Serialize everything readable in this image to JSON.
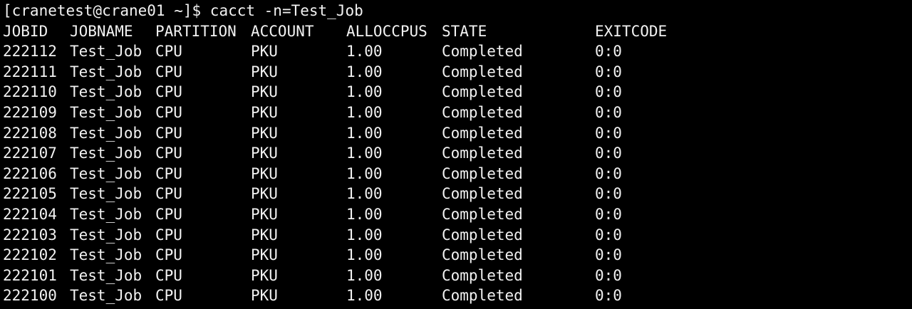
{
  "terminal": {
    "prompt": "[cranetest@crane01 ~]$ ",
    "command": "cacct -n=Test_Job",
    "colors": {
      "background": "#000000",
      "foreground": "#f2f2f2"
    },
    "headers": [
      "JOBID",
      "JOBNAME",
      "PARTITION",
      "ACCOUNT",
      "ALLOCCPUS",
      "STATE",
      "EXITCODE"
    ],
    "rows": [
      [
        "222112",
        "Test_Job",
        "CPU",
        "PKU",
        "1.00",
        "Completed",
        "0:0"
      ],
      [
        "222111",
        "Test_Job",
        "CPU",
        "PKU",
        "1.00",
        "Completed",
        "0:0"
      ],
      [
        "222110",
        "Test_Job",
        "CPU",
        "PKU",
        "1.00",
        "Completed",
        "0:0"
      ],
      [
        "222109",
        "Test_Job",
        "CPU",
        "PKU",
        "1.00",
        "Completed",
        "0:0"
      ],
      [
        "222108",
        "Test_Job",
        "CPU",
        "PKU",
        "1.00",
        "Completed",
        "0:0"
      ],
      [
        "222107",
        "Test_Job",
        "CPU",
        "PKU",
        "1.00",
        "Completed",
        "0:0"
      ],
      [
        "222106",
        "Test_Job",
        "CPU",
        "PKU",
        "1.00",
        "Completed",
        "0:0"
      ],
      [
        "222105",
        "Test_Job",
        "CPU",
        "PKU",
        "1.00",
        "Completed",
        "0:0"
      ],
      [
        "222104",
        "Test_Job",
        "CPU",
        "PKU",
        "1.00",
        "Completed",
        "0:0"
      ],
      [
        "222103",
        "Test_Job",
        "CPU",
        "PKU",
        "1.00",
        "Completed",
        "0:0"
      ],
      [
        "222102",
        "Test_Job",
        "CPU",
        "PKU",
        "1.00",
        "Completed",
        "0:0"
      ],
      [
        "222101",
        "Test_Job",
        "CPU",
        "PKU",
        "1.00",
        "Completed",
        "0:0"
      ],
      [
        "222100",
        "Test_Job",
        "CPU",
        "PKU",
        "1.00",
        "Completed",
        "0:0"
      ]
    ]
  }
}
